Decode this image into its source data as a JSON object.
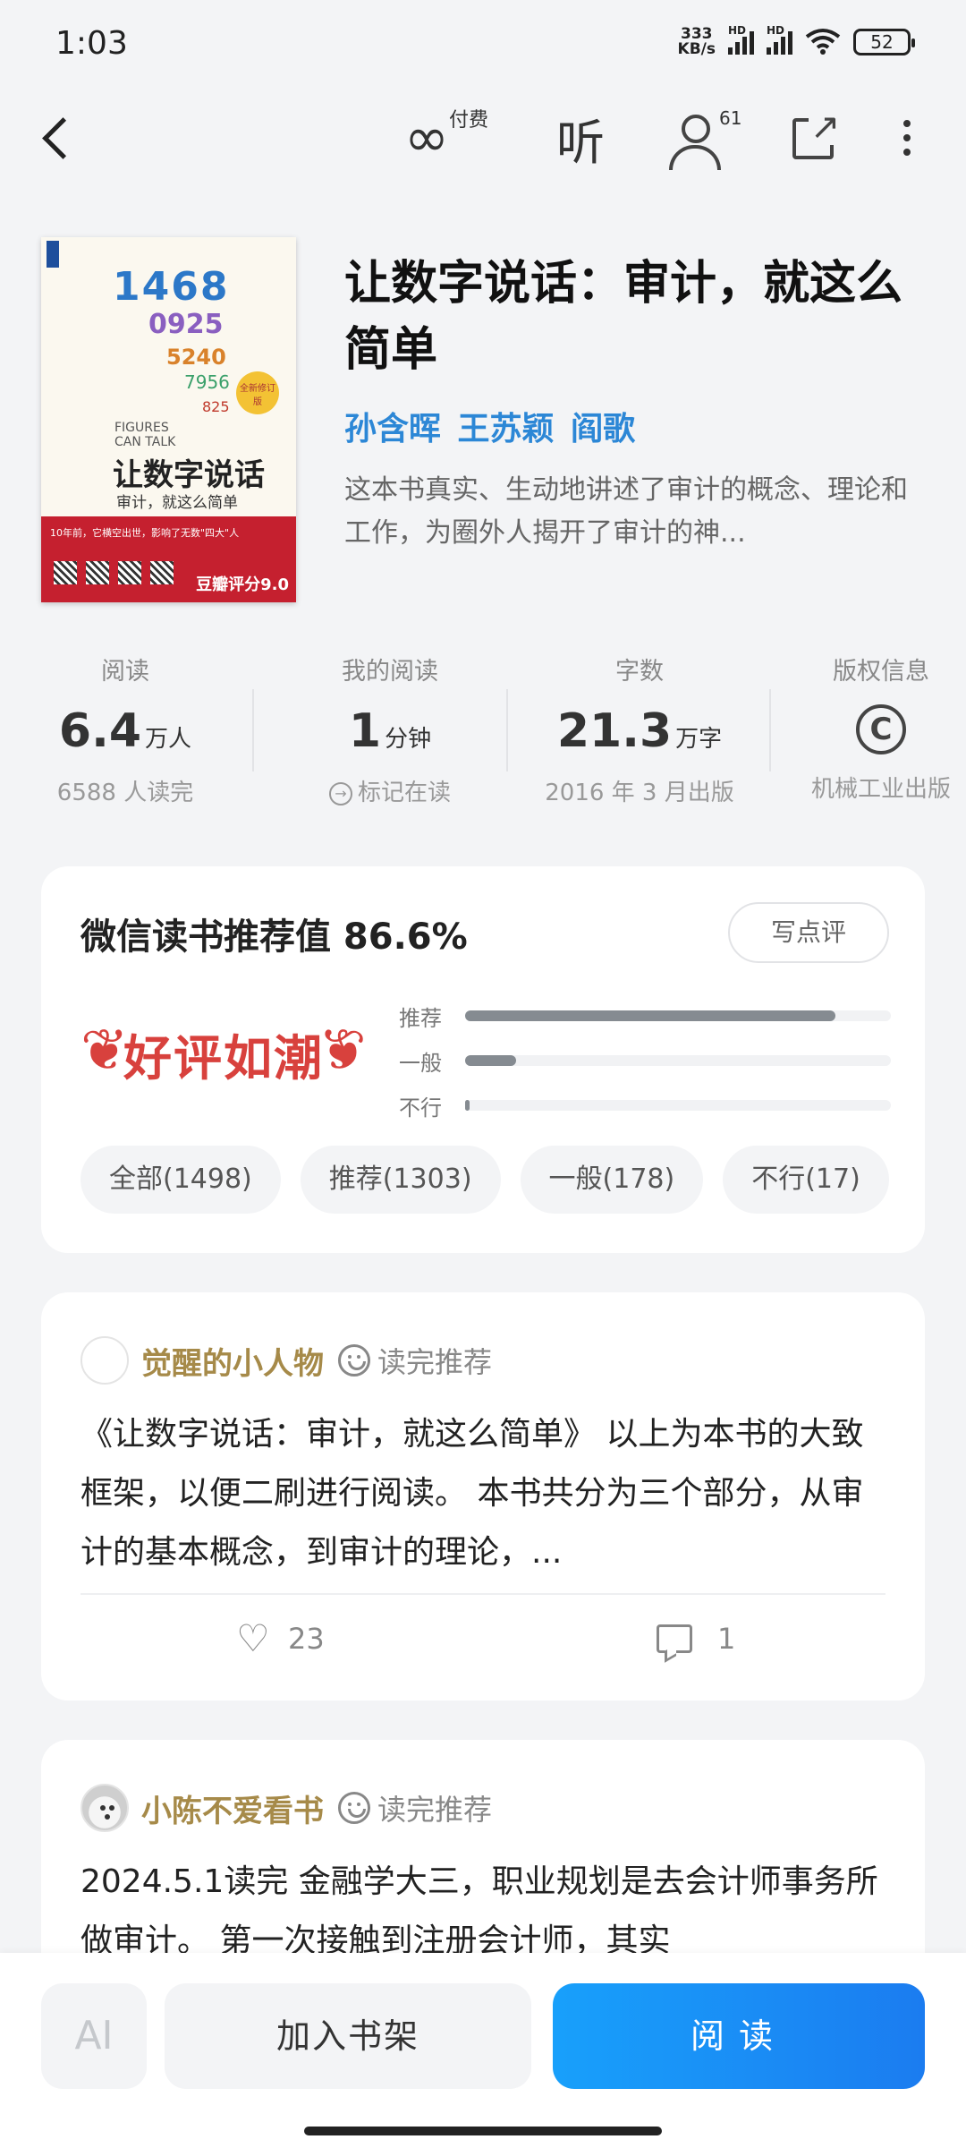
{
  "status_bar": {
    "time": "1:03",
    "net_speed_value": "333",
    "net_speed_unit": "KB/s",
    "hd1": "HD",
    "hd2": "HD",
    "battery": "52"
  },
  "nav": {
    "paid_label": "付费",
    "listen_label": "听",
    "user_count": "61"
  },
  "book": {
    "title": "让数字说话：审计，就这么简单",
    "authors": "孙含晖 王苏颖 阎歌",
    "intro": "这本书真实、生动地讲述了审计的概念、理论和工作，为圈外人揭开了审计的神...",
    "cover": {
      "title": "让数字说话",
      "subtitle": "审计，就这么简单",
      "en_line1": "FIGURES",
      "en_line2": "CAN TALK",
      "badge": "全新修订版",
      "band_text": "10年前，它横空出世，影响了无数\"四大\"人",
      "score": "豆瓣评分9.0"
    }
  },
  "stats": [
    {
      "label": "阅读",
      "value": "6.4",
      "unit": "万人",
      "sub": "6588 人读完"
    },
    {
      "label": "我的阅读",
      "value": "1",
      "unit": "分钟",
      "sub": "标记在读"
    },
    {
      "label": "字数",
      "value": "21.3",
      "unit": "万字",
      "sub": "2016 年 3 月出版"
    },
    {
      "label": "版权信息",
      "icon": "copyright-icon",
      "sub": "机械工业出版"
    }
  ],
  "rating": {
    "title": "微信读书推荐值 86.6%",
    "write_button": "写点评",
    "badge_text": "好评如潮",
    "bars": [
      {
        "label": "推荐",
        "fraction": 0.87
      },
      {
        "label": "一般",
        "fraction": 0.12
      },
      {
        "label": "不行",
        "fraction": 0.01
      }
    ],
    "filters": [
      "全部(1498)",
      "推荐(1303)",
      "一般(178)",
      "不行(17)"
    ]
  },
  "reviews": [
    {
      "user": "觉醒的小人物",
      "tag": "读完推荐",
      "text": "《让数字说话：审计，就这么简单》 以上为本书的大致框架，以便二刷进行阅读。 本书共分为三个部分，从审计的基本概念，到审计的理论，...",
      "likes": "23",
      "comments": "1"
    },
    {
      "user": "小陈不爱看书",
      "tag": "读完推荐",
      "text": "2024.5.1读完 金融学大三，职业规划是去会计师事务所做审计。 第一次接触到注册会计师，其实"
    }
  ],
  "bottom": {
    "ai_label": "AI",
    "shelf_button": "加入书架",
    "read_button": "阅读"
  },
  "colors": {
    "accent_blue": "#1b7cf0",
    "author_blue": "#2c87d6",
    "badge_red": "#d8413d",
    "username_gold": "#a68a49"
  }
}
